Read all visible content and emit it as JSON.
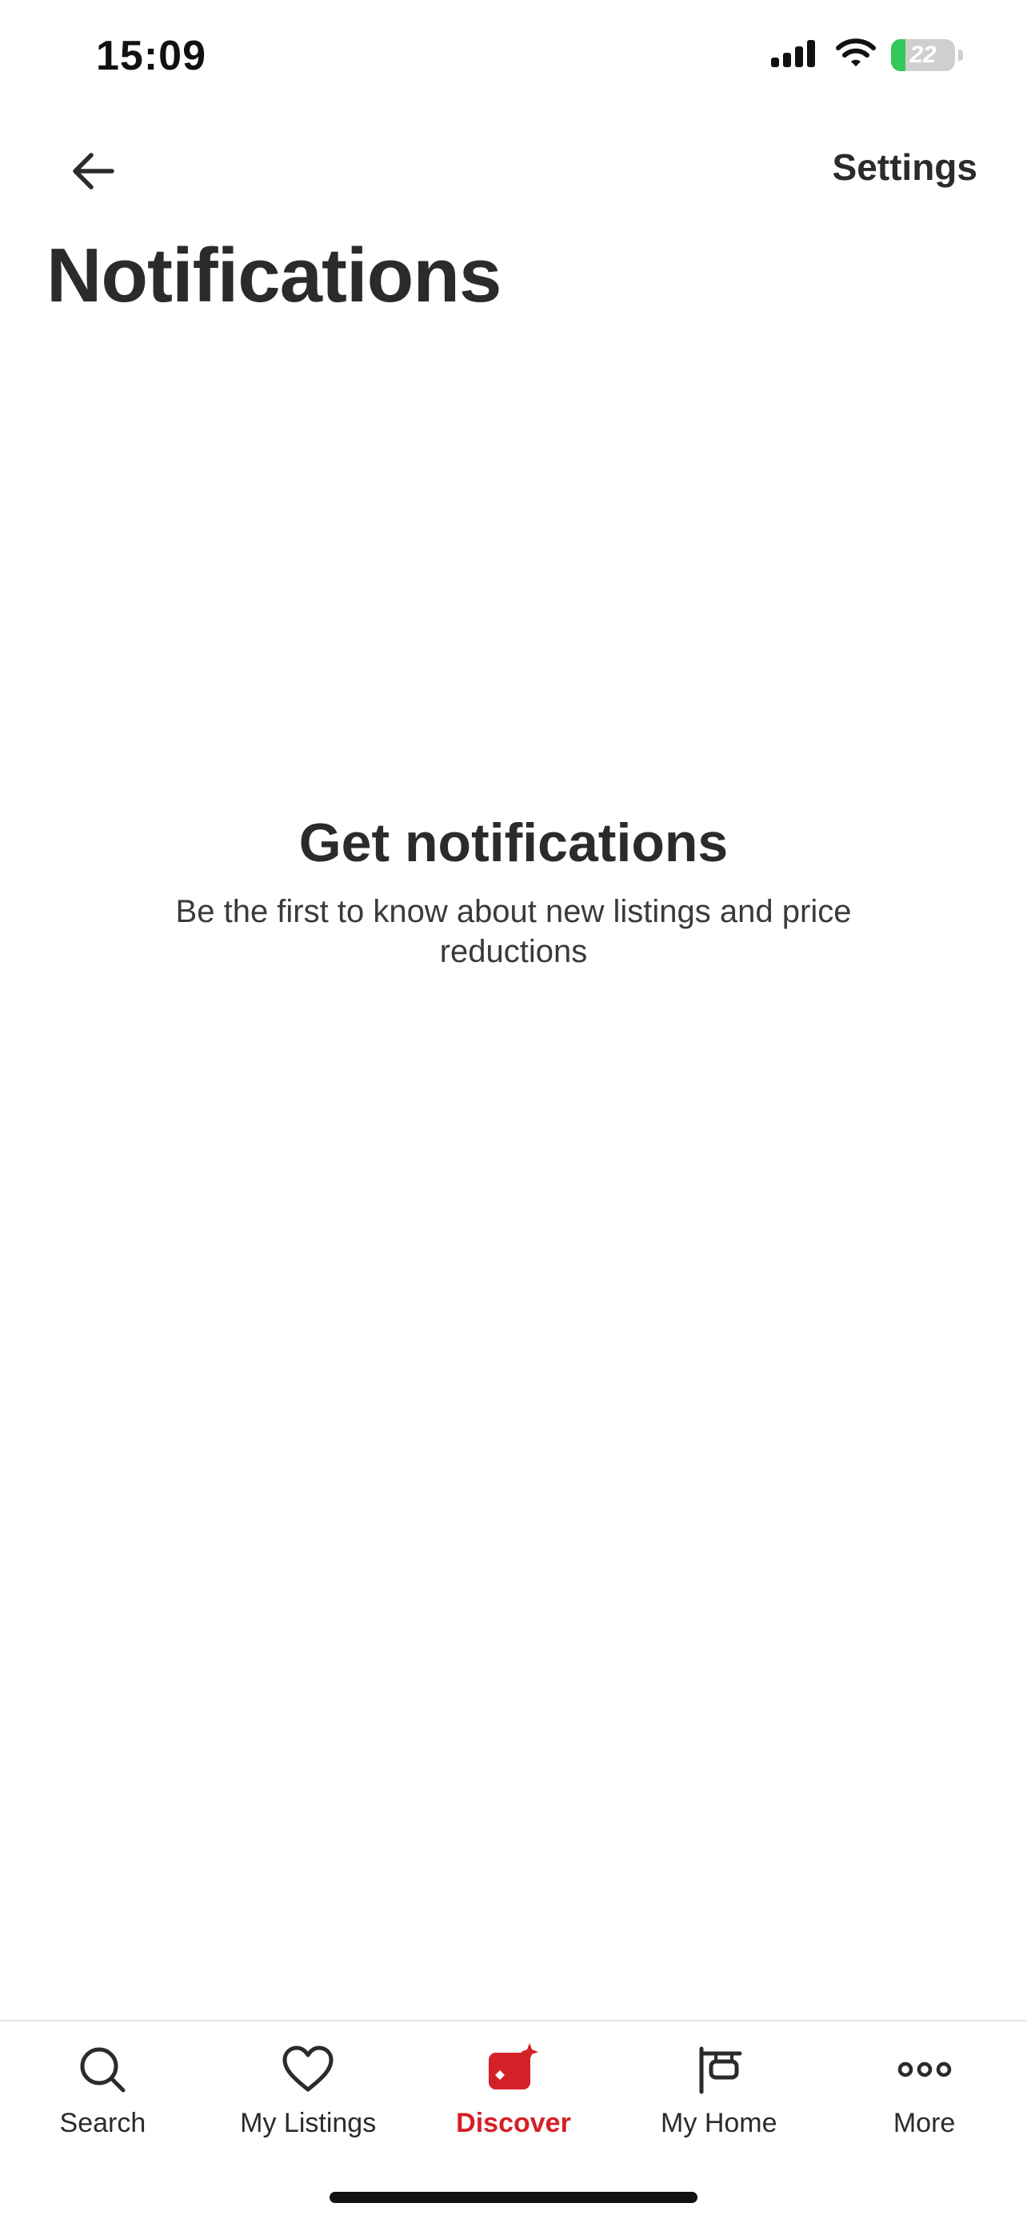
{
  "status_bar": {
    "time": "15:09",
    "battery_level": "22",
    "battery_fraction": 0.22,
    "battery_color": "#34c759"
  },
  "header": {
    "back_icon": "arrow-left-icon",
    "settings_label": "Settings",
    "title": "Notifications"
  },
  "empty_state": {
    "title": "Get notifications",
    "description": "Be the first to know about new listings and price reductions"
  },
  "tab_bar": {
    "active_color": "#d42027",
    "tabs": [
      {
        "label": "Search",
        "icon": "search-icon",
        "active": false
      },
      {
        "label": "My Listings",
        "icon": "heart-icon",
        "active": false
      },
      {
        "label": "Discover",
        "icon": "discover-icon",
        "active": true
      },
      {
        "label": "My Home",
        "icon": "home-sign-icon",
        "active": false
      },
      {
        "label": "More",
        "icon": "more-icon",
        "active": false
      }
    ]
  }
}
